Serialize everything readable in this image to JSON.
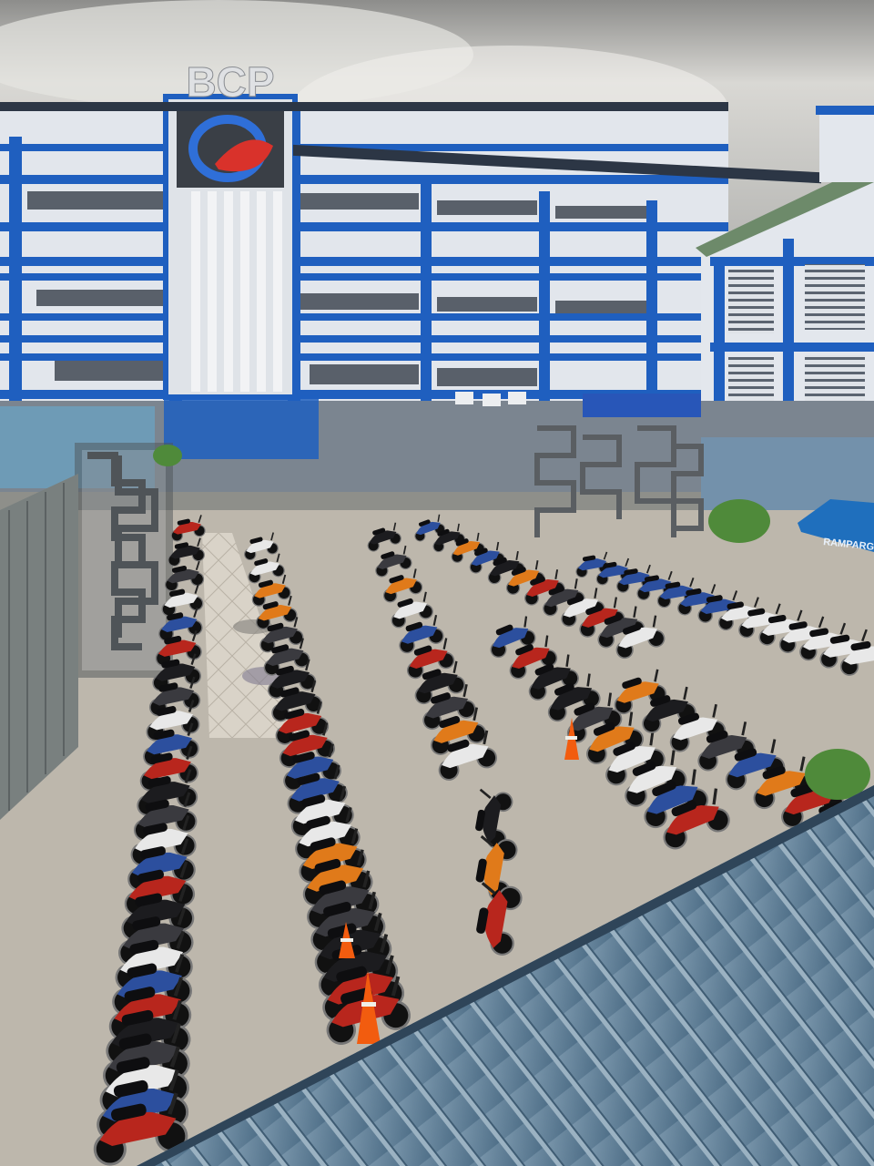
{
  "photo": {
    "building_sign": "BCP",
    "tent_text": "RAMPARGAS",
    "colors": {
      "sky": "#cfcfcc",
      "building_blue": "#1f5fbf",
      "building_wall": "#e4e7ec",
      "pavement": "#bcb6ab",
      "roof": "#5f7f99",
      "motorcycle": "#1c1c1f",
      "cone": "#f25c0f"
    }
  }
}
